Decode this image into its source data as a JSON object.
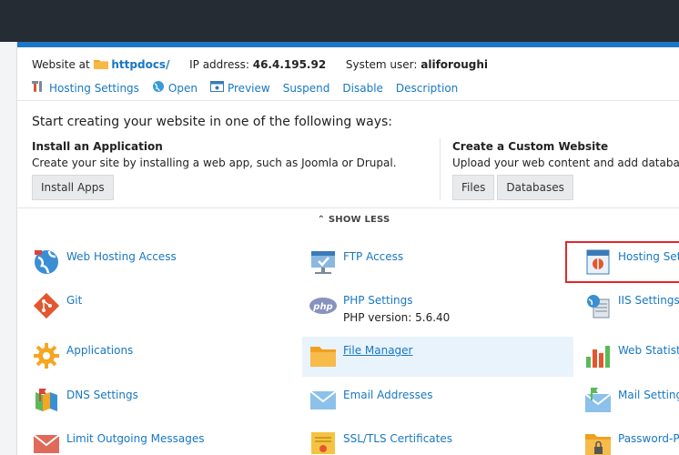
{
  "info": {
    "website_label": "Website at",
    "website_value": "httpdocs/",
    "ip_label": "IP address:",
    "ip_value": "46.4.195.92",
    "user_label": "System user:",
    "user_value": "aliforoughi"
  },
  "actions": [
    {
      "label": "Hosting Settings",
      "icon": "tools-icon"
    },
    {
      "label": "Open",
      "icon": "globe-icon"
    },
    {
      "label": "Preview",
      "icon": "preview-icon"
    },
    {
      "label": "Suspend"
    },
    {
      "label": "Disable"
    },
    {
      "label": "Description"
    }
  ],
  "start": {
    "title": "Start creating your website in one of the following ways:",
    "app": {
      "title": "Install an Application",
      "desc": "Create your site by installing a web app, such as Joomla or Drupal.",
      "button": "Install Apps"
    },
    "custom": {
      "title": "Create a Custom Website",
      "desc": "Upload your web content and add databases.",
      "files_button": "Files",
      "databases_button": "Databases"
    }
  },
  "show_less": "SHOW LESS",
  "tools": {
    "web_hosting_access": "Web Hosting Access",
    "ftp_access": "FTP Access",
    "hosting_settings": "Hosting Setti",
    "git": "Git",
    "php_settings": "PHP Settings",
    "php_version": "PHP version: 5.6.40",
    "iis_settings": "IIS Settings",
    "applications": "Applications",
    "file_manager": "File Manager",
    "web_statistics": "Web Statistic",
    "dns_settings": "DNS Settings",
    "email_addresses": "Email Addresses",
    "mail_settings": "Mail Settings",
    "limit_outgoing": "Limit Outgoing Messages",
    "ssl_tls": "SSL/TLS Certificates",
    "password_protected": "Password-Pro"
  },
  "colors": {
    "accent": "#1b77c4",
    "link": "#1877c3",
    "highlight_border": "#e1262b"
  }
}
